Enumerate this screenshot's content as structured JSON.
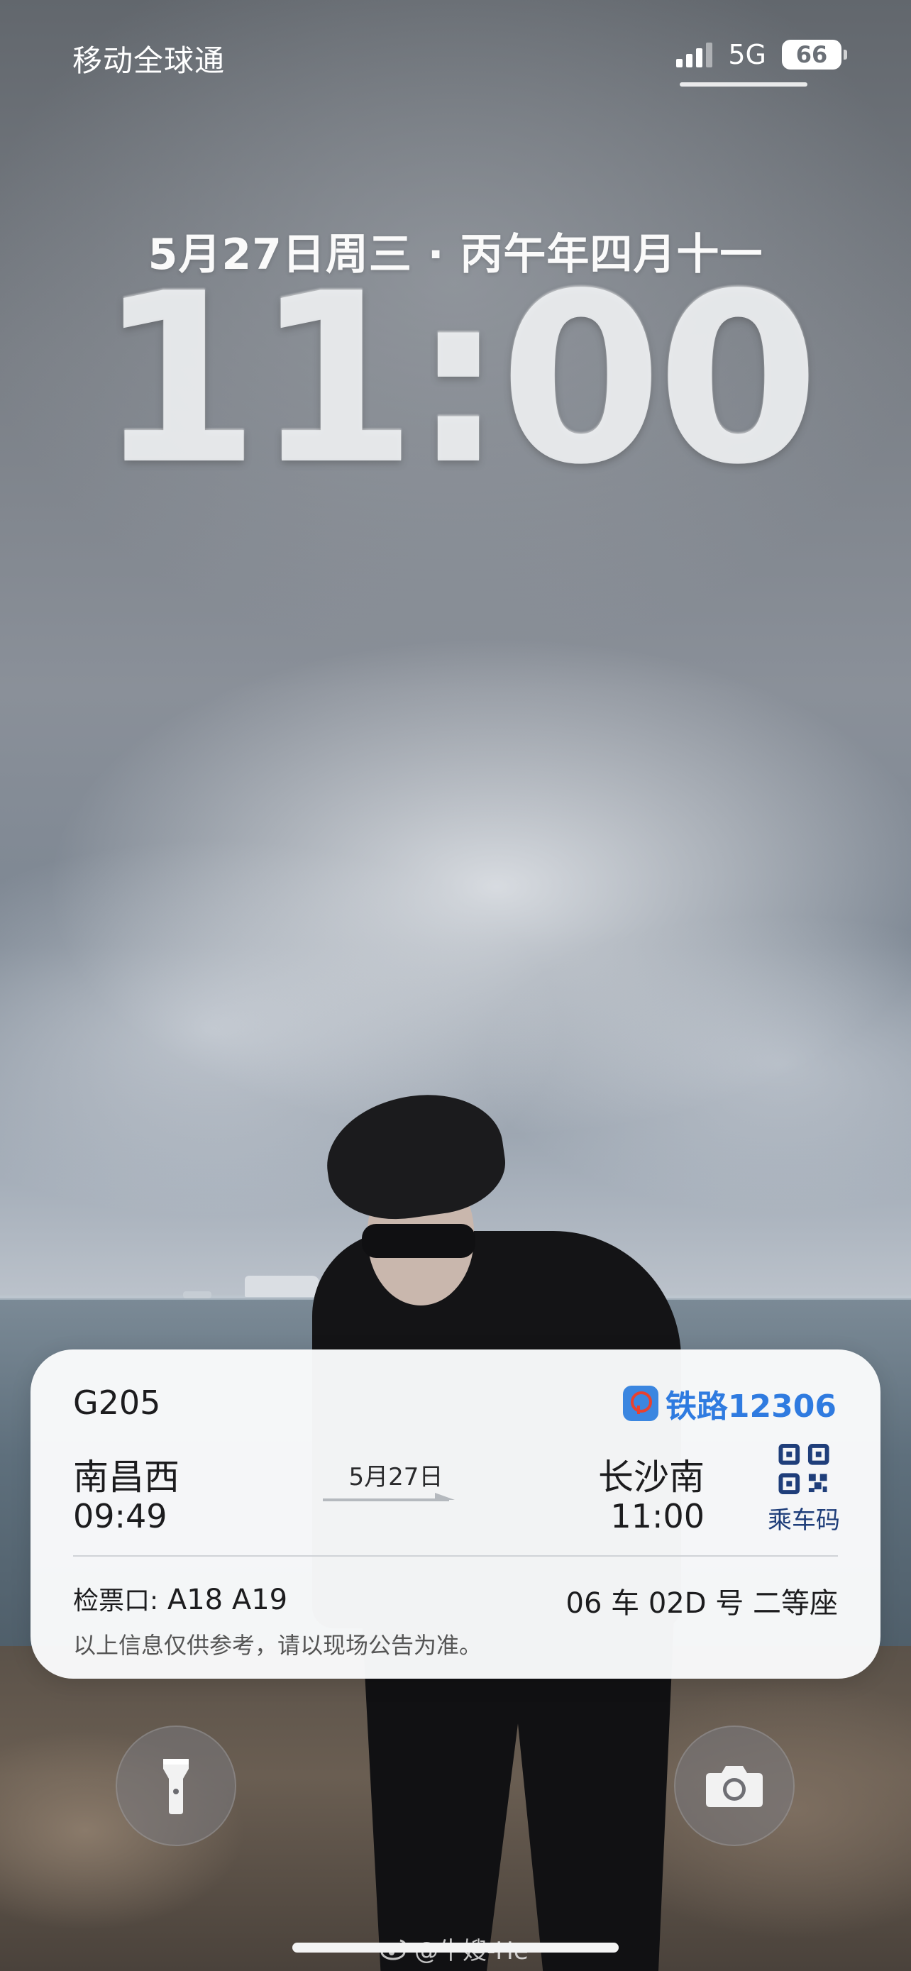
{
  "status_bar": {
    "carrier": "移动全球通",
    "network": "5G",
    "battery": "66"
  },
  "lock_screen": {
    "date": "5月27日周三 · 丙午年四月十一",
    "time": "11:00"
  },
  "train_widget": {
    "train_number": "G205",
    "app_name": "铁路12306",
    "from_station": "南昌西",
    "depart_time": "09:49",
    "travel_date": "5月27日",
    "to_station": "长沙南",
    "arrive_time": "11:00",
    "qr_label": "乘车码",
    "gate_label": "检票口:",
    "gate_value": "A18 A19",
    "seat_info": "06 车 02D 号 二等座",
    "disclaimer": "以上信息仅供参考，请以现场公告为准。"
  },
  "controls": {
    "flashlight_icon": "flashlight-icon",
    "camera_icon": "camera-icon"
  },
  "watermark": {
    "text": "@牛嫂-He",
    "icon": "weibo-icon"
  },
  "colors": {
    "app_accent": "#2f7be0",
    "qr_color": "#1f3e7a",
    "card_bg": "#fafbfc"
  }
}
